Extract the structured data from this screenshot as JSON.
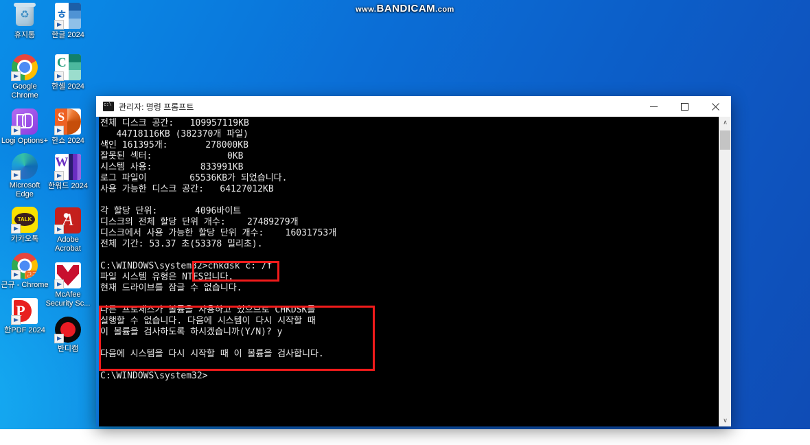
{
  "watermark": {
    "prefix": "www.",
    "brand": "BANDICAM",
    "suffix": ".com"
  },
  "desktop": {
    "columns": [
      {
        "name": "column-1",
        "icons": [
          {
            "label": "휴지통",
            "icon": "recycle-bin-icon",
            "shortcut": false
          },
          {
            "label": "Google Chrome",
            "icon": "google-chrome-icon",
            "shortcut": true
          },
          {
            "label": "Logi Options+",
            "icon": "logi-options-icon",
            "shortcut": true
          },
          {
            "label": "Microsoft Edge",
            "icon": "microsoft-edge-icon",
            "shortcut": true
          },
          {
            "label": "카카오톡",
            "icon": "kakaotalk-icon",
            "shortcut": true
          },
          {
            "label": "근규 - Chrome",
            "icon": "chrome-profile-icon",
            "shortcut": true
          },
          {
            "label": "한PDF 2024",
            "icon": "hanpdf-icon",
            "shortcut": true
          }
        ]
      },
      {
        "name": "column-2",
        "icons": [
          {
            "label": "한글 2024",
            "icon": "hangul-word-icon",
            "shortcut": true
          },
          {
            "label": "한셀 2024",
            "icon": "hancell-icon",
            "shortcut": true
          },
          {
            "label": "한쇼 2024",
            "icon": "hanshow-icon",
            "shortcut": true
          },
          {
            "label": "한워드 2024",
            "icon": "hanword-icon",
            "shortcut": true
          },
          {
            "label": "Adobe Acrobat",
            "icon": "adobe-acrobat-icon",
            "shortcut": true
          },
          {
            "label": "McAfee Security Sc...",
            "icon": "mcafee-icon",
            "shortcut": true
          },
          {
            "label": "반디캠",
            "icon": "bandicam-icon",
            "shortcut": true
          }
        ]
      }
    ]
  },
  "cmd_window": {
    "title": "관리자: 명령 프롬프트",
    "icon": "command-prompt-icon",
    "controls": {
      "minimize": "minimize-button",
      "maximize": "maximize-button",
      "close": "close-button"
    },
    "scrollbar": {
      "up_arrow": "∧",
      "down_arrow": "∨"
    },
    "lines": [
      "전체 디스크 공간:   109957119KB",
      "   44718116KB (382370개 파일)",
      "색인 161395개:       278000KB",
      "잘못된 섹터:              0KB",
      "시스템 사용:         833991KB",
      "로그 파일이        65536KB가 되었습니다.",
      "사용 가능한 디스크 공간:   64127012KB",
      "",
      "각 할당 단위:       4096바이트",
      "디스크의 전체 할당 단위 개수:    27489279개",
      "디스크에서 사용 가능한 할당 단위 개수:    16031753개",
      "전체 기간: 53.37 초(53378 밀리초).",
      "",
      "C:\\WINDOWS\\system32>chkdsk c: /f",
      "파일 시스템 유형은 NTFS입니다.",
      "현재 드라이브를 잠글 수 없습니다.",
      "",
      "다른 프로세스가 볼륨을 사용하고 있으므로 CHKDSK를",
      "실행할 수 없습니다. 다음에 시스템이 다시 시작할 때",
      "이 볼륨을 검사하도록 하시겠습니까(Y/N)? y",
      "",
      "다음에 시스템을 다시 시작할 때 이 볼륨을 검사합니다.",
      "",
      "C:\\WINDOWS\\system32>"
    ],
    "annotations": [
      {
        "name": "highlight-chkdsk-command",
        "color": "#f21b1b"
      },
      {
        "name": "highlight-chkdsk-message",
        "color": "#f21b1b"
      }
    ]
  },
  "colors": {
    "desktop_blue_light": "#17b4f5",
    "desktop_blue_dark": "#0f4cb5",
    "console_bg": "#000000",
    "console_text": "#e9e9e9",
    "annotation_red": "#f21b1b",
    "titlebar_bg": "#ffffff"
  }
}
